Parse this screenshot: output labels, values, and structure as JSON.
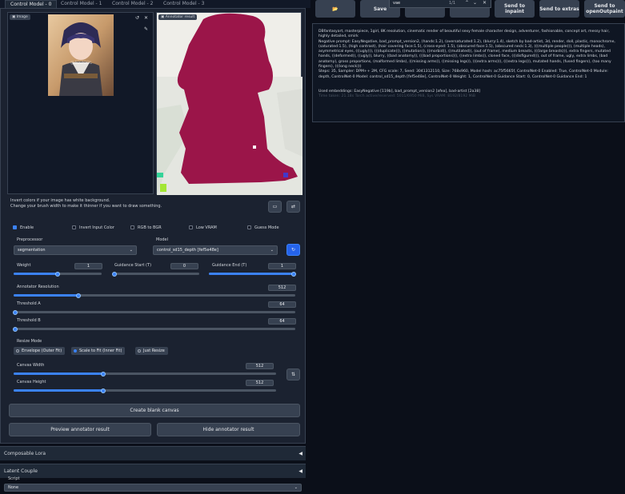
{
  "tabs": [
    "Control Model - 0",
    "Control Model - 1",
    "Control Model - 2",
    "Control Model - 3"
  ],
  "image_panel": {
    "image_label": "Image",
    "annotator_label": "Annotator result",
    "watermark": "@AIXPOOL"
  },
  "hint_text": {
    "line1": "Invert colors if your image has white background.",
    "line2": "Change your brush width to make it thinner if you want to draw something."
  },
  "checkboxes": [
    {
      "label": "Enable",
      "checked": true
    },
    {
      "label": "Invert Input Color",
      "checked": false
    },
    {
      "label": "RGB to BGR",
      "checked": false
    },
    {
      "label": "Low VRAM",
      "checked": false
    },
    {
      "label": "Guess Mode",
      "checked": false
    }
  ],
  "preprocessor": {
    "label": "Preprocessor",
    "value": "segmentation"
  },
  "model": {
    "label": "Model",
    "value": "control_sd15_depth [fef5e48e]"
  },
  "weight": {
    "label": "Weight",
    "value": "1",
    "fraction": 0.5
  },
  "guidance_start": {
    "label": "Guidance Start (T)",
    "value": "0",
    "fraction": 0.0
  },
  "guidance_end": {
    "label": "Guidance End (T)",
    "value": "1",
    "fraction": 1.0
  },
  "annotator_resolution": {
    "label": "Annotator Resolution",
    "value": "512",
    "fraction": 0.23
  },
  "threshold_a": {
    "label": "Threshold A",
    "value": "64",
    "fraction": 0.0
  },
  "threshold_b": {
    "label": "Threshold B",
    "value": "64",
    "fraction": 0.0
  },
  "resize_mode": {
    "label": "Resize Mode",
    "options": [
      "Envelope (Outer Fit)",
      "Scale to Fit (Inner Fit)",
      "Just Resize"
    ],
    "selected": 1
  },
  "canvas_width": {
    "label": "Canvas Width",
    "value": "512",
    "fraction": 0.34
  },
  "canvas_height": {
    "label": "Canvas Height",
    "value": "512",
    "fraction": 0.34
  },
  "buttons": {
    "create_blank": "Create blank canvas",
    "preview": "Preview annotator result",
    "hide": "Hide annotator result"
  },
  "accordions": {
    "composable_lora": "Composable Lora",
    "latent_couple": "Latent Couple",
    "script_label": "Script",
    "script_value": "None"
  },
  "top_bar": {
    "folder_icon": "folder-icon",
    "save": "Save",
    "search_value": "vae",
    "search_count": "1/1",
    "send_inpaint": "Send to inpaint",
    "send_extras": "Send to extras",
    "send_openoutpaint": "Send to openOutpaint"
  },
  "generation_info": {
    "prompt": "DBfantasyart, masterpiece, 1girl, 8K resolution, cinematic render of beautiful sexy female character design, adventurer, fashionable, concept art, messy hair, highly detailed, smirk",
    "negative": "Negative prompt: EasyNegative, bad_prompt_version2, (hands:1.2), (oversaturated:1.2), (blurry:1.4), sketch by bad-artist, 3d, render, doll, plastic, monochrome, (saturated:1.5), (high contrast), (hair covering face:1.5), (cross-eyed: 1.5), (obscured face:1.5), (obscured neck:1.3), (((multiple people))), (multiple heads), asymmetrical eyes, (((ugly))), (((duplicate))), ((mutation)), ((morbid)), ((mutilated)), (out of frame), medium breasts, (((large breasts))), extra fingers, mutated hands, ((deformed)), ((ugly)), blurry, ((bad anatomy)), (((bad proportions))), ((extra limbs)), cloned face, (((disfigured))), out of frame, ugly, extra limbs, (bad anatomy), gross proportions, (malformed limbs), ((missing arms)), ((missing legs)), (((extra arms))), (((extra legs))), mutated hands, (fused fingers), (too many fingers), (((long neck)))",
    "steps": "Steps: 35, Sampler: DPM++ 2M, CFG scale: 7, Seed: 3041312110, Size: 768x960, Model hash: ac75f5665f, ControlNet-0 Enabled: True, ControlNet-0 Module: depth, ControlNet-0 Model: control_sd15_depth [fef5e48e], ControlNet-0 Weight: 1, ControlNet-0 Guidance Start: 0, ControlNet-0 Guidance End: 1",
    "embeddings": "Used embeddings: EasyNegative [119b], bad_prompt_version2 [afea], bad-artist [2a38]",
    "faded": "Time taken: 21.18s  Torch active/reserved: 5011/6950 MiB, Sys VRAM: 8192/8192 MiB"
  },
  "colors": {
    "background": "#0b0f19",
    "panel": "#1f2937",
    "accent": "#3b82f6",
    "mask": "#9b1549"
  }
}
